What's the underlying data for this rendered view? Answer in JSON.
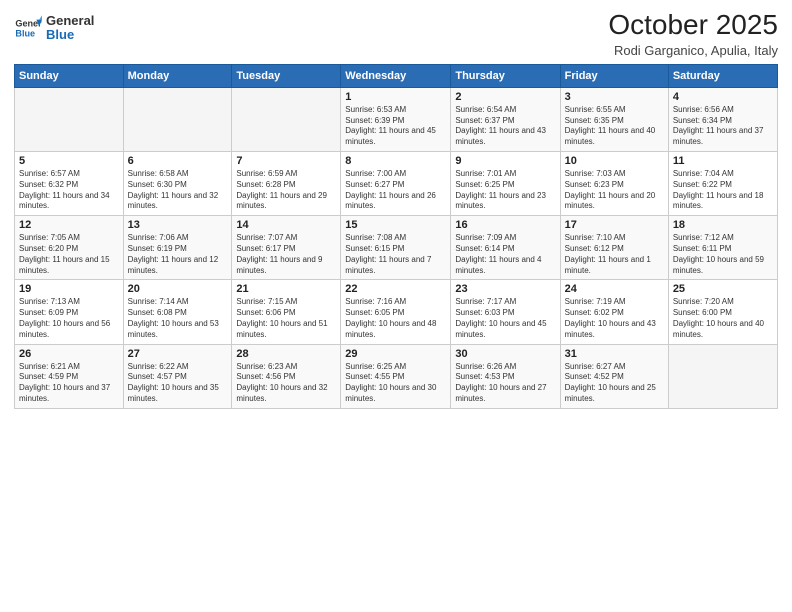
{
  "header": {
    "logo_line1": "General",
    "logo_line2": "Blue",
    "month": "October 2025",
    "location": "Rodi Garganico, Apulia, Italy"
  },
  "weekdays": [
    "Sunday",
    "Monday",
    "Tuesday",
    "Wednesday",
    "Thursday",
    "Friday",
    "Saturday"
  ],
  "weeks": [
    [
      {
        "day": "",
        "info": ""
      },
      {
        "day": "",
        "info": ""
      },
      {
        "day": "",
        "info": ""
      },
      {
        "day": "1",
        "info": "Sunrise: 6:53 AM\nSunset: 6:39 PM\nDaylight: 11 hours and 45 minutes."
      },
      {
        "day": "2",
        "info": "Sunrise: 6:54 AM\nSunset: 6:37 PM\nDaylight: 11 hours and 43 minutes."
      },
      {
        "day": "3",
        "info": "Sunrise: 6:55 AM\nSunset: 6:35 PM\nDaylight: 11 hours and 40 minutes."
      },
      {
        "day": "4",
        "info": "Sunrise: 6:56 AM\nSunset: 6:34 PM\nDaylight: 11 hours and 37 minutes."
      }
    ],
    [
      {
        "day": "5",
        "info": "Sunrise: 6:57 AM\nSunset: 6:32 PM\nDaylight: 11 hours and 34 minutes."
      },
      {
        "day": "6",
        "info": "Sunrise: 6:58 AM\nSunset: 6:30 PM\nDaylight: 11 hours and 32 minutes."
      },
      {
        "day": "7",
        "info": "Sunrise: 6:59 AM\nSunset: 6:28 PM\nDaylight: 11 hours and 29 minutes."
      },
      {
        "day": "8",
        "info": "Sunrise: 7:00 AM\nSunset: 6:27 PM\nDaylight: 11 hours and 26 minutes."
      },
      {
        "day": "9",
        "info": "Sunrise: 7:01 AM\nSunset: 6:25 PM\nDaylight: 11 hours and 23 minutes."
      },
      {
        "day": "10",
        "info": "Sunrise: 7:03 AM\nSunset: 6:23 PM\nDaylight: 11 hours and 20 minutes."
      },
      {
        "day": "11",
        "info": "Sunrise: 7:04 AM\nSunset: 6:22 PM\nDaylight: 11 hours and 18 minutes."
      }
    ],
    [
      {
        "day": "12",
        "info": "Sunrise: 7:05 AM\nSunset: 6:20 PM\nDaylight: 11 hours and 15 minutes."
      },
      {
        "day": "13",
        "info": "Sunrise: 7:06 AM\nSunset: 6:19 PM\nDaylight: 11 hours and 12 minutes."
      },
      {
        "day": "14",
        "info": "Sunrise: 7:07 AM\nSunset: 6:17 PM\nDaylight: 11 hours and 9 minutes."
      },
      {
        "day": "15",
        "info": "Sunrise: 7:08 AM\nSunset: 6:15 PM\nDaylight: 11 hours and 7 minutes."
      },
      {
        "day": "16",
        "info": "Sunrise: 7:09 AM\nSunset: 6:14 PM\nDaylight: 11 hours and 4 minutes."
      },
      {
        "day": "17",
        "info": "Sunrise: 7:10 AM\nSunset: 6:12 PM\nDaylight: 11 hours and 1 minute."
      },
      {
        "day": "18",
        "info": "Sunrise: 7:12 AM\nSunset: 6:11 PM\nDaylight: 10 hours and 59 minutes."
      }
    ],
    [
      {
        "day": "19",
        "info": "Sunrise: 7:13 AM\nSunset: 6:09 PM\nDaylight: 10 hours and 56 minutes."
      },
      {
        "day": "20",
        "info": "Sunrise: 7:14 AM\nSunset: 6:08 PM\nDaylight: 10 hours and 53 minutes."
      },
      {
        "day": "21",
        "info": "Sunrise: 7:15 AM\nSunset: 6:06 PM\nDaylight: 10 hours and 51 minutes."
      },
      {
        "day": "22",
        "info": "Sunrise: 7:16 AM\nSunset: 6:05 PM\nDaylight: 10 hours and 48 minutes."
      },
      {
        "day": "23",
        "info": "Sunrise: 7:17 AM\nSunset: 6:03 PM\nDaylight: 10 hours and 45 minutes."
      },
      {
        "day": "24",
        "info": "Sunrise: 7:19 AM\nSunset: 6:02 PM\nDaylight: 10 hours and 43 minutes."
      },
      {
        "day": "25",
        "info": "Sunrise: 7:20 AM\nSunset: 6:00 PM\nDaylight: 10 hours and 40 minutes."
      }
    ],
    [
      {
        "day": "26",
        "info": "Sunrise: 6:21 AM\nSunset: 4:59 PM\nDaylight: 10 hours and 37 minutes."
      },
      {
        "day": "27",
        "info": "Sunrise: 6:22 AM\nSunset: 4:57 PM\nDaylight: 10 hours and 35 minutes."
      },
      {
        "day": "28",
        "info": "Sunrise: 6:23 AM\nSunset: 4:56 PM\nDaylight: 10 hours and 32 minutes."
      },
      {
        "day": "29",
        "info": "Sunrise: 6:25 AM\nSunset: 4:55 PM\nDaylight: 10 hours and 30 minutes."
      },
      {
        "day": "30",
        "info": "Sunrise: 6:26 AM\nSunset: 4:53 PM\nDaylight: 10 hours and 27 minutes."
      },
      {
        "day": "31",
        "info": "Sunrise: 6:27 AM\nSunset: 4:52 PM\nDaylight: 10 hours and 25 minutes."
      },
      {
        "day": "",
        "info": ""
      }
    ]
  ]
}
